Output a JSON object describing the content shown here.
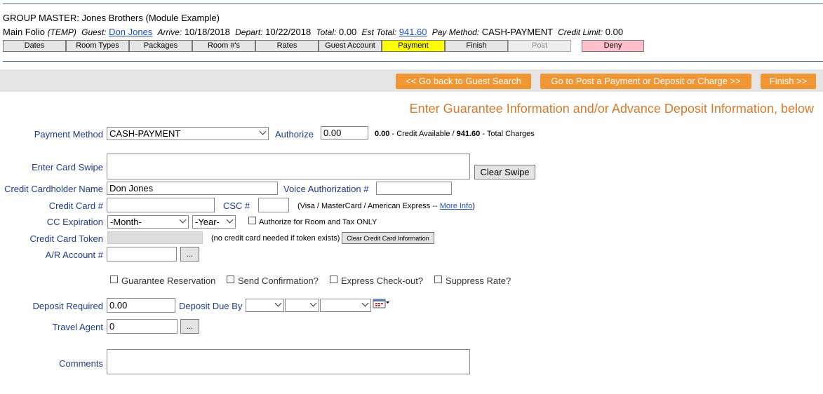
{
  "header": {
    "title": "GROUP MASTER: Jones Brothers (Module Example)",
    "folio_label": "Main Folio",
    "folio_temp": "(TEMP)",
    "guest_label": "Guest:",
    "guest_name": "Don Jones",
    "arrive_label": "Arrive:",
    "arrive_date": "10/18/2018",
    "depart_label": "Depart:",
    "depart_date": "10/22/2018",
    "total_label": "Total:",
    "total_value": "0.00",
    "est_total_label": "Est Total:",
    "est_total_value": "941.60",
    "pay_method_label": "Pay Method:",
    "pay_method_value": "CASH-PAYMENT",
    "credit_limit_label": "Credit Limit:",
    "credit_limit_value": "0.00"
  },
  "tabs": [
    {
      "label": "Dates",
      "state": "normal"
    },
    {
      "label": "Room Types",
      "state": "normal"
    },
    {
      "label": "Packages",
      "state": "normal"
    },
    {
      "label": "Room #'s",
      "state": "normal"
    },
    {
      "label": "Rates",
      "state": "normal"
    },
    {
      "label": "Guest Account",
      "state": "normal"
    },
    {
      "label": "Payment",
      "state": "active"
    },
    {
      "label": "Finish",
      "state": "normal"
    },
    {
      "label": "Post",
      "state": "disabled"
    },
    {
      "label": "Deny",
      "state": "deny"
    }
  ],
  "actions": {
    "back_label": "<< Go back to Guest Search",
    "post_label": "Go to Post a Payment or Deposit or Charge >>",
    "finish_label": "Finish >>"
  },
  "heading": "Enter Guarantee Information and/or Advance Deposit Information, below",
  "form": {
    "payment_method_label": "Payment Method",
    "payment_method_value": "CASH-PAYMENT",
    "authorize_label": "Authorize",
    "authorize_value": "0.00",
    "credit_available_value": "0.00",
    "credit_available_text": "- Credit Available  /",
    "total_charges_value": "941.60",
    "total_charges_text": "- Total Charges",
    "card_swipe_label": "Enter Card Swipe",
    "clear_swipe_label": "Clear Swipe",
    "cardholder_label": "Credit Cardholder Name",
    "cardholder_value": "Don Jones",
    "voice_auth_label": "Voice Authorization #",
    "card_number_label": "Credit Card #",
    "csc_label": "CSC #",
    "card_types_text": "(Visa / MasterCard / American Express --",
    "more_info_label": "More Info",
    "close_paren": ")",
    "cc_expiration_label": "CC Expiration",
    "month_value": "-Month-",
    "year_value": "-Year-",
    "authorize_room_tax_label": "Authorize for Room and Tax ONLY",
    "token_label": "Credit Card Token",
    "token_note": "(no credit card needed if token exists)",
    "clear_cc_info_label": "Clear Credit Card Information",
    "ar_account_label": "A/R Account #",
    "ellipsis_label": "...",
    "guarantee_label": "Guarantee Reservation",
    "send_confirmation_label": "Send Confirmation?",
    "express_checkout_label": "Express Check-out?",
    "suppress_rate_label": "Suppress Rate?",
    "deposit_required_label": "Deposit Required",
    "deposit_required_value": "0.00",
    "deposit_due_label": "Deposit Due By",
    "travel_agent_label": "Travel Agent",
    "travel_agent_value": "0",
    "comments_label": "Comments"
  },
  "colors": {
    "accent_orange": "#f09633",
    "heading_orange": "#d9792a",
    "label_blue": "#1f3c88",
    "active_tab": "#ffff00",
    "deny_tab": "#ffc0cb"
  }
}
